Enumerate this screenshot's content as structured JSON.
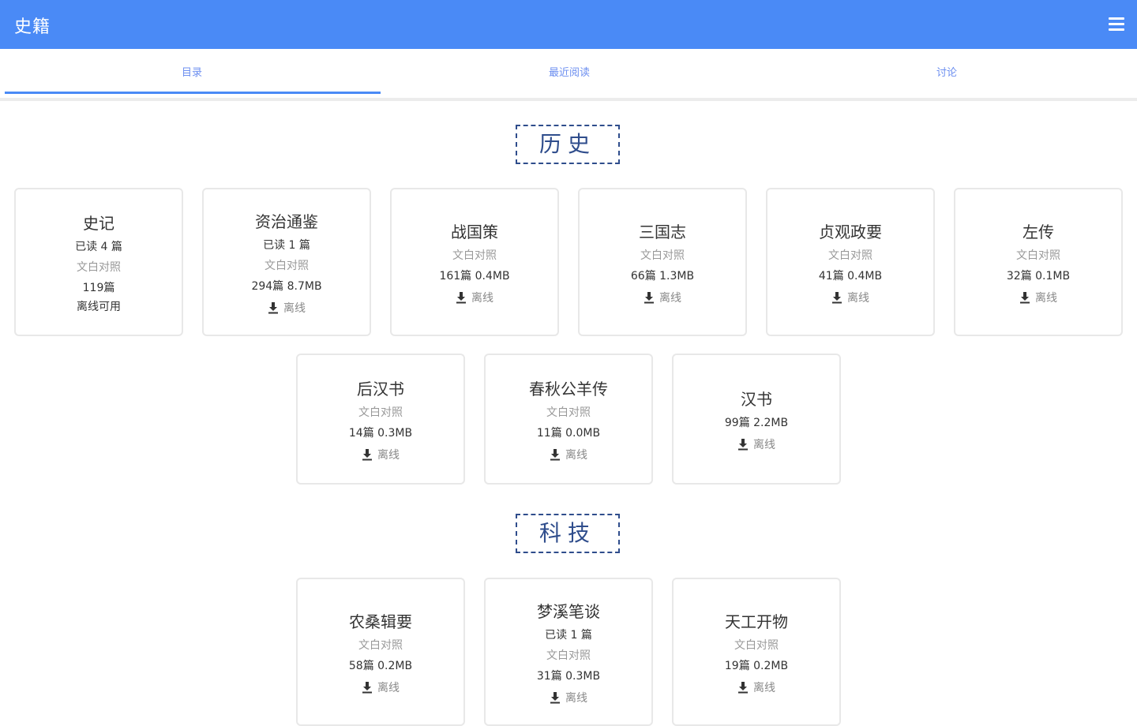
{
  "app": {
    "title": "史籍"
  },
  "tabs": [
    {
      "label": "目录"
    },
    {
      "label": "最近阅读"
    },
    {
      "label": "讨论"
    }
  ],
  "sections": [
    {
      "title": "历史"
    },
    {
      "title": "科技"
    }
  ],
  "books": [
    {
      "title": "史记",
      "read": "已读 4 篇",
      "note": "文白对照",
      "stats": "119篇",
      "offline_status": "离线可用"
    },
    {
      "title": "资治通鉴",
      "read": "已读 1 篇",
      "note": "文白对照",
      "stats": "294篇 8.7MB",
      "download": "离线"
    },
    {
      "title": "战国策",
      "note": "文白对照",
      "stats": "161篇 0.4MB",
      "download": "离线"
    },
    {
      "title": "三国志",
      "note": "文白对照",
      "stats": "66篇 1.3MB",
      "download": "离线"
    },
    {
      "title": "贞观政要",
      "note": "文白对照",
      "stats": "41篇 0.4MB",
      "download": "离线"
    },
    {
      "title": "左传",
      "note": "文白对照",
      "stats": "32篇 0.1MB",
      "download": "离线"
    },
    {
      "title": "后汉书",
      "note": "文白对照",
      "stats": "14篇 0.3MB",
      "download": "离线"
    },
    {
      "title": "春秋公羊传",
      "note": "文白对照",
      "stats": "11篇 0.0MB",
      "download": "离线"
    },
    {
      "title": "汉书",
      "stats": "99篇 2.2MB",
      "download": "离线"
    },
    {
      "title": "农桑辑要",
      "note": "文白对照",
      "stats": "58篇 0.2MB",
      "download": "离线"
    },
    {
      "title": "梦溪笔谈",
      "read": "已读 1 篇",
      "note": "文白对照",
      "stats": "31篇 0.3MB",
      "download": "离线"
    },
    {
      "title": "天工开物",
      "note": "文白对照",
      "stats": "19篇 0.2MB",
      "download": "离线"
    }
  ],
  "colors": {
    "appbar": "#4a8af6",
    "tab_text": "#6d8ff0",
    "heading": "#2f4d8c"
  },
  "icons": {
    "menu": "menu-icon",
    "download": "download-icon"
  }
}
